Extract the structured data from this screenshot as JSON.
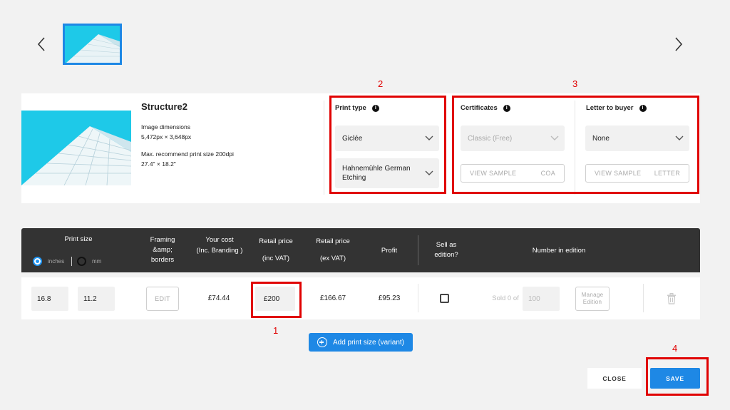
{
  "artwork": {
    "title": "Structure2",
    "dimensions_label": "Image dimensions",
    "dimensions": "5,472px × 3,648px",
    "max_print_label": "Max. recommend print size 200dpi",
    "max_print_size": "27.4\" × 18.2\""
  },
  "print_type": {
    "label": "Print type",
    "printing_method": "Giclée",
    "paper": "Hahnemühle German Etching"
  },
  "certificates": {
    "label": "Certificates",
    "selected": "Classic (Free)",
    "view_sample": "VIEW SAMPLE",
    "view_sample_tag": "COA"
  },
  "letter": {
    "label": "Letter to buyer",
    "selected": "None",
    "view_sample": "VIEW SAMPLE",
    "view_sample_tag": "LETTER"
  },
  "table": {
    "headers": {
      "print_size": "Print size",
      "framing": "Framing\n&amp;\nborders",
      "your_cost": "Your cost\n(Inc. Branding )",
      "retail_inc": "Retail price\n\n(inc VAT)",
      "retail_ex": "Retail price\n\n(ex VAT)",
      "profit": "Profit",
      "sell_as_edition": "Sell as\nedition?",
      "number_in_edition": "Number in edition"
    },
    "units": {
      "inches": "inches",
      "mm": "mm",
      "selected": "inches"
    },
    "row": {
      "width": "16.8",
      "height": "11.2",
      "edit": "EDIT",
      "your_cost": "£74.44",
      "retail_inc": "£200",
      "retail_ex": "£166.67",
      "profit": "£95.23",
      "sell_as_edition": false,
      "sold_of": "Sold 0 of",
      "edition_size": "100",
      "manage_edition": "Manage\nEdition"
    }
  },
  "actions": {
    "add_variant": "Add print size (variant)",
    "close": "CLOSE",
    "save": "SAVE"
  },
  "annotations": [
    "1",
    "2",
    "3",
    "4"
  ],
  "colors": {
    "accent": "#1e88e5",
    "highlight": "#e00000",
    "header_bg": "#333333"
  }
}
